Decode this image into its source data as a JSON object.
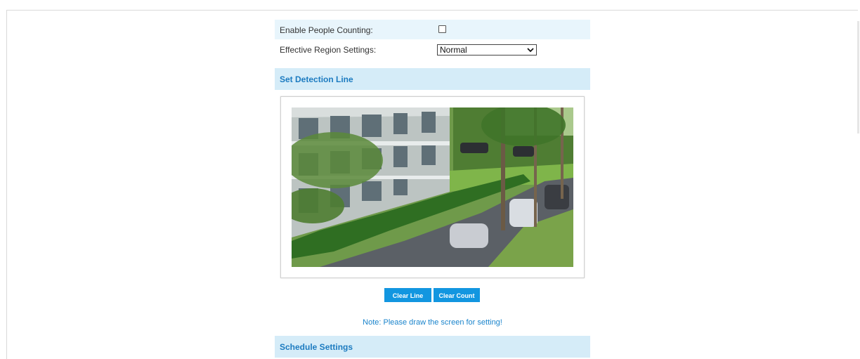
{
  "form": {
    "enable_people_counting_label": "Enable People Counting:",
    "enable_people_counting_checked": false,
    "effective_region_label": "Effective Region Settings:",
    "effective_region_value": "Normal"
  },
  "sections": {
    "detection_line_title": "Set Detection Line",
    "schedule_title": "Schedule Settings"
  },
  "buttons": {
    "clear_line": "Clear Line",
    "clear_count": "Clear Count"
  },
  "note": "Note: Please draw the screen for setting!",
  "colors": {
    "accent": "#1296e0",
    "header_bg": "#d5ecf8",
    "row_shade": "#e8f5fc",
    "header_text": "#1c7bc0"
  },
  "icons": {
    "select_chevron": "chevron-down-icon"
  }
}
